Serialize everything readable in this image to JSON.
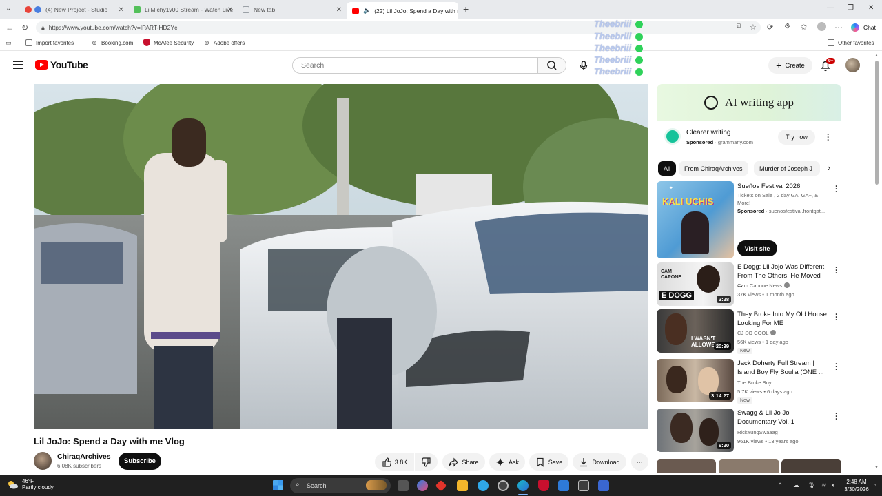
{
  "browser": {
    "tabs": [
      {
        "label": "(4) New Project - Studio",
        "color": "#e8443a"
      },
      {
        "label": "LilMichy1v00 Stream - Watch Live",
        "color": "#53c05a"
      },
      {
        "label": "New tab",
        "color": "#9aa0a6"
      },
      {
        "label": "(22) Lil JoJo: Spend a Day with me",
        "color": "#ff0000"
      }
    ],
    "url": "https://www.youtube.com/watch?v=IPART-HD2Yc",
    "chat_label": "Chat",
    "favorites": [
      {
        "label": "Import favorites"
      },
      {
        "label": "Booking.com"
      },
      {
        "label": "McAfee Security"
      },
      {
        "label": "Adobe offers"
      }
    ],
    "other_favorites": "Other favorites"
  },
  "overlay": {
    "lines": [
      "Theebriii",
      "Theebriii",
      "Theebriii",
      "Theebriii",
      "Theebriii"
    ]
  },
  "youtube": {
    "logo_text": "YouTube",
    "search_placeholder": "Search",
    "create_label": "Create",
    "notification_badge": "9+"
  },
  "video": {
    "title": "Lil JoJo: Spend a Day with me Vlog",
    "channel": "ChiraqArchives",
    "subscribers": "6.08K subscribers",
    "subscribe_label": "Subscribe",
    "actions": {
      "likes": "3.8K",
      "share": "Share",
      "ask": "Ask",
      "save": "Save",
      "download": "Download"
    }
  },
  "sidebar": {
    "ad": {
      "banner": "AI writing app",
      "title": "Clearer writing",
      "sponsored": "Sponsored",
      "domain": "grammarly.com",
      "cta": "Try now"
    },
    "chips": [
      "All",
      "From ChiraqArchives",
      "Murder of Joseph J"
    ],
    "recommendations": [
      {
        "title": "Sueños Festival 2026",
        "channel": "Tickets on Sale , 2 day GA, GA+, & More!",
        "meta": "Sponsored",
        "meta2": "suenosfestival.frontgat...",
        "cta": "Visit site",
        "thumb_text": "KALI UCHIS"
      },
      {
        "title": "E Dogg: Lil Jojo Was Different From The Others; He Moved ...",
        "channel": "Cam Capone News",
        "meta": "37K views • 1 month ago",
        "duration": "3:28",
        "thumb_text": "E DOGG"
      },
      {
        "title": "They Broke Into My Old House Looking For ME",
        "channel": "CJ SO COOL",
        "meta": "56K views • 1 day ago",
        "badge": "New",
        "duration": "20:39",
        "thumb_text": "I WASN'T ALLOWED"
      },
      {
        "title": "Jack Doherty Full Stream | Island Boy Fly Soulja (ONE ...",
        "channel": "The Broke Boy",
        "meta": "5.7K views • 6 days ago",
        "badge": "New",
        "duration": "3:14:27"
      },
      {
        "title": "Swagg & Lil Jo Jo Documentary Vol. 1",
        "channel": "RickYungSwaaag",
        "meta": "961K views • 13 years ago",
        "duration": "6:20"
      }
    ]
  },
  "taskbar": {
    "temp": "46°F",
    "weather": "Partly cloudy",
    "search_placeholder": "Search",
    "time": "2:48 AM",
    "date": "3/30/2026"
  }
}
